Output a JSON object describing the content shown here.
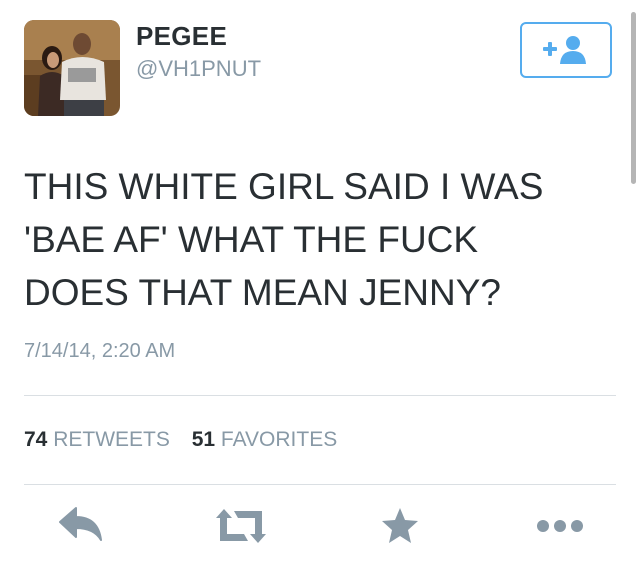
{
  "user": {
    "display_name": "PEGEE",
    "handle": "@VH1PNUT",
    "avatar_icon": "profile-photo"
  },
  "follow_button": {
    "icon": "add-user-icon",
    "color": "#55acee"
  },
  "tweet": {
    "text": "THIS WHITE GIRL SAID I WAS\n'BAE AF'  WHAT THE FUCK\nDOES THAT MEAN JENNY?",
    "timestamp": "7/14/14, 2:20 AM"
  },
  "stats": {
    "retweets_count": "74",
    "retweets_label": "RETWEETS",
    "favorites_count": "51",
    "favorites_label": "FAVORITES"
  },
  "actions": {
    "reply_icon": "reply-icon",
    "retweet_icon": "retweet-icon",
    "favorite_icon": "star-icon",
    "more_icon": "more-icon",
    "icon_color": "#8899a6"
  }
}
